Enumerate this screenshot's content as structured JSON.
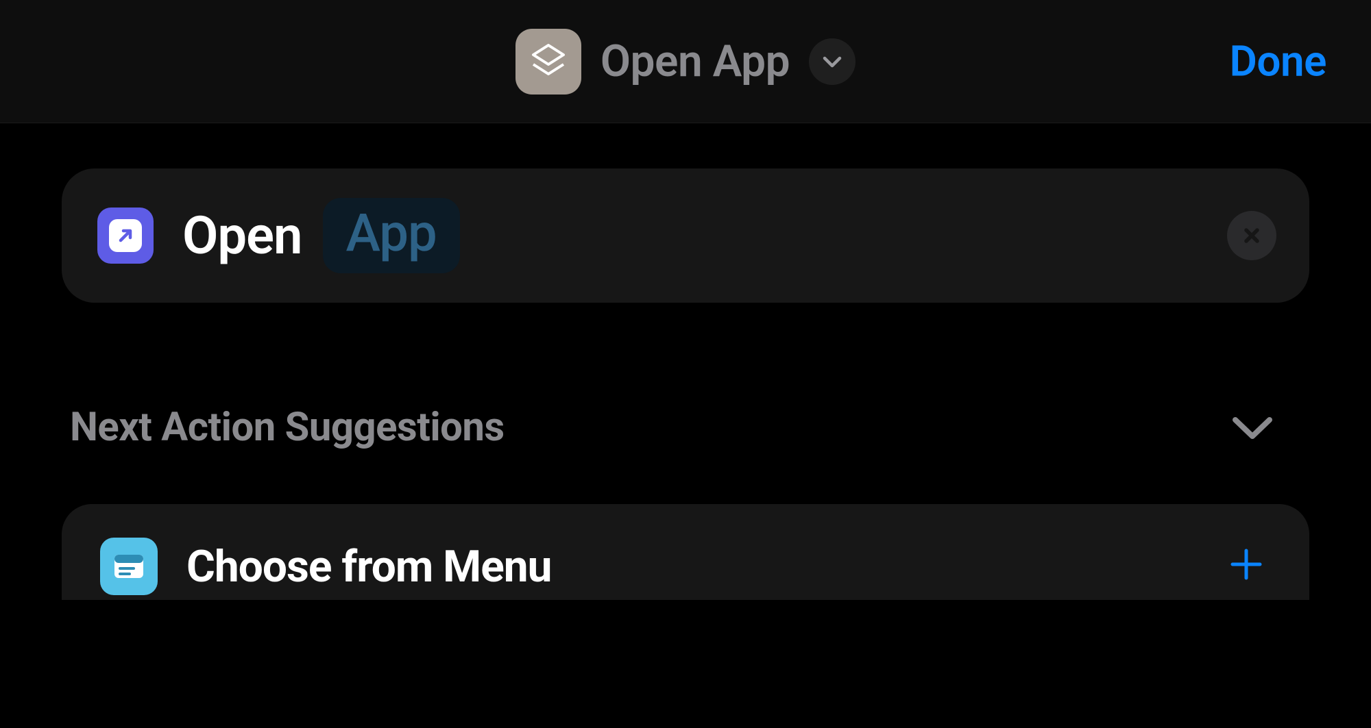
{
  "header": {
    "title": "Open App",
    "done_label": "Done"
  },
  "action_card": {
    "verb": "Open",
    "token": "App"
  },
  "suggestions": {
    "title": "Next Action Suggestions",
    "items": [
      {
        "label": "Choose from Menu"
      }
    ]
  }
}
